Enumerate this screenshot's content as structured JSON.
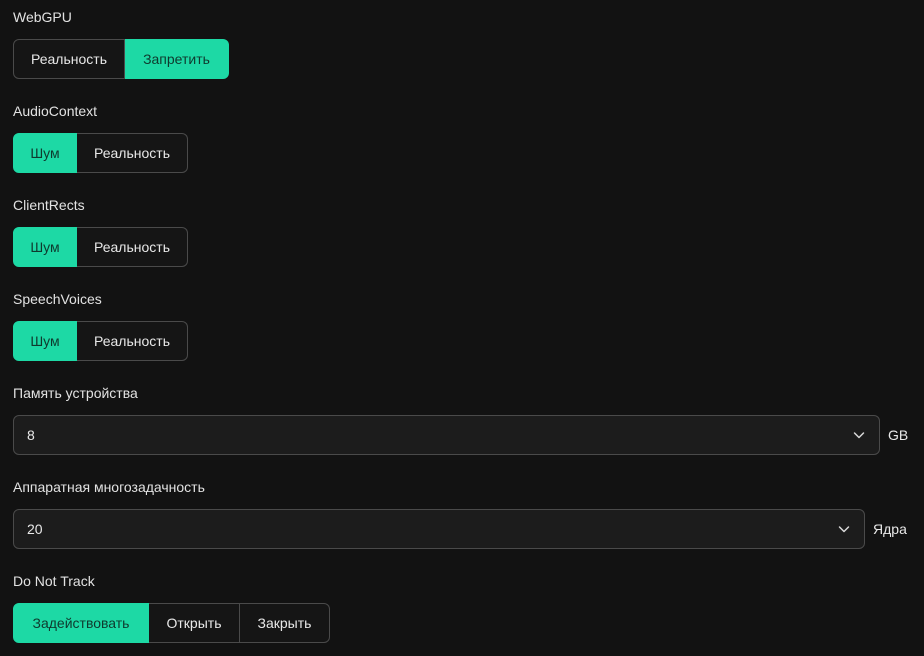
{
  "webgpu": {
    "label": "WebGPU",
    "options": [
      "Реальность",
      "Запретить"
    ],
    "selected": "Запретить"
  },
  "audio_context": {
    "label": "AudioContext",
    "options": [
      "Шум",
      "Реальность"
    ],
    "selected": "Шум"
  },
  "client_rects": {
    "label": "ClientRects",
    "options": [
      "Шум",
      "Реальность"
    ],
    "selected": "Шум"
  },
  "speech_voices": {
    "label": "SpeechVoices",
    "options": [
      "Шум",
      "Реальность"
    ],
    "selected": "Шум"
  },
  "device_memory": {
    "label": "Память устройства",
    "value": "8",
    "unit": "GB",
    "icon": "chevron-down-icon"
  },
  "hardware_concurrency": {
    "label": "Аппаратная многозадачность",
    "value": "20",
    "unit": "Ядра",
    "icon": "chevron-down-icon"
  },
  "do_not_track": {
    "label": "Do Not Track",
    "options": [
      "Задействовать",
      "Открыть",
      "Закрыть"
    ],
    "selected": "Задействовать"
  },
  "colors": {
    "background": "#121212",
    "accent": "#1dd9a5",
    "border": "#4a4a4a"
  }
}
